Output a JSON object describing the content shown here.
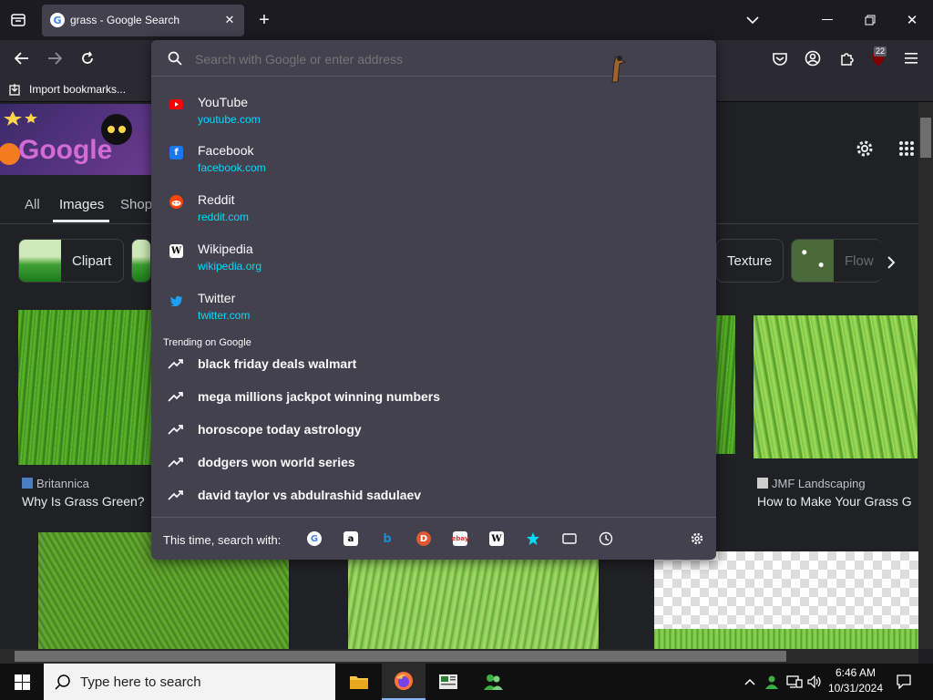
{
  "browser": {
    "tab_title": "grass - Google Search",
    "new_tab_symbol": "+",
    "urlbar_placeholder": "Search with Google or enter address",
    "bookmark_import": "Import bookmarks...",
    "extensions_badge": "22"
  },
  "google": {
    "nav_tabs": [
      "All",
      "Images",
      "Shop"
    ],
    "chips": [
      "Clipart",
      "Texture",
      "Flow"
    ],
    "results": [
      {
        "source": "Britannica",
        "title": "Why Is Grass Green?"
      },
      {
        "source": "JMF Landscaping",
        "title": "How to Make Your Grass G"
      }
    ]
  },
  "popup": {
    "top_sites": [
      {
        "name": "YouTube",
        "url": "youtube.com",
        "icon": "youtube-icon",
        "color": "#ff0000"
      },
      {
        "name": "Facebook",
        "url": "facebook.com",
        "icon": "facebook-icon",
        "color": "#1877f2"
      },
      {
        "name": "Reddit",
        "url": "reddit.com",
        "icon": "reddit-icon",
        "color": "#ff4500"
      },
      {
        "name": "Wikipedia",
        "url": "wikipedia.org",
        "icon": "wikipedia-icon",
        "color": "#ffffff"
      },
      {
        "name": "Twitter",
        "url": "twitter.com",
        "icon": "twitter-icon",
        "color": "#1da1f2"
      }
    ],
    "trending_heading": "Trending on Google",
    "trending": [
      "black friday deals walmart",
      "mega millions jackpot winning numbers",
      "horoscope today astrology",
      "dodgers won world series",
      "david taylor vs abdulrashid sadulaev"
    ],
    "search_with_label": "This time, search with:"
  },
  "taskbar": {
    "search_placeholder": "Type here to search",
    "time": "6:46 AM",
    "date": "10/31/2024"
  },
  "colors": {
    "accent": "#00ddff",
    "popup_bg": "#42414d",
    "chrome_bg": "#2b2a33"
  }
}
